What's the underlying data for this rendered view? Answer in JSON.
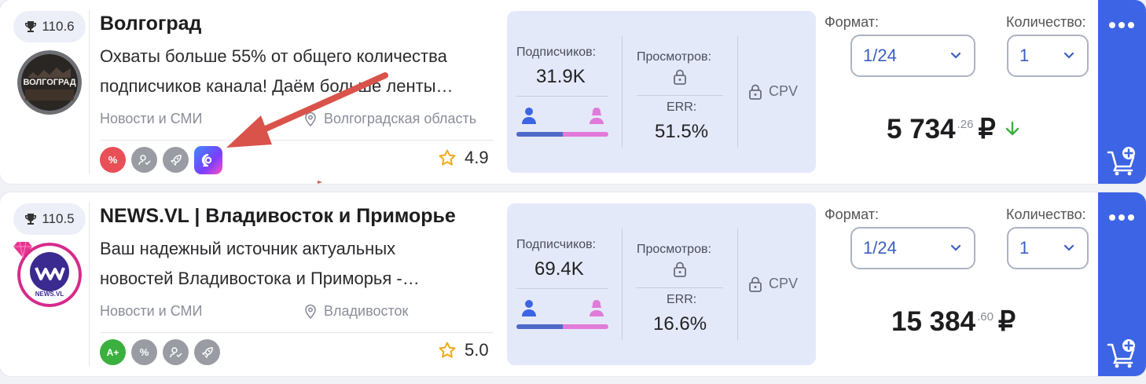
{
  "labels": {
    "subscribers": "Подписчиков:",
    "views": "Просмотров:",
    "err": "ERR:",
    "cpv": "CPV",
    "format": "Формат:",
    "quantity": "Количество:",
    "currency": "₽"
  },
  "channels": [
    {
      "rank": "110.6",
      "title": "Волгоград",
      "avatar_text": "ВОЛГОГРАД",
      "desc_line1": "Охваты больше 55% от общего количества",
      "desc_line2": "подписчиков канала! Даём больше ленты…",
      "category": "Новости и СМИ",
      "location": "Волгоградская область",
      "badges": [
        "%",
        "user-check",
        "rocket",
        "app"
      ],
      "rating": "4.9",
      "subscribers": "31.9K",
      "err_value": "51.5%",
      "male_share": 0.5,
      "format": "1/24",
      "quantity": "1",
      "price_main": "5 734",
      "price_cents": ".26",
      "price_trend": "down",
      "trend_color": "#3bb03f"
    },
    {
      "rank": "110.5",
      "title": "NEWS.VL | Владивосток и Приморье",
      "avatar_text": "NEWS.VL",
      "desc_line1": "Ваш надежный источник актуальных",
      "desc_line2": "новостей Владивостока и Приморья -…",
      "category": "Новости и СМИ",
      "location": "Владивосток",
      "badges": [
        "A+",
        "%",
        "user-check",
        "rocket"
      ],
      "rating": "5.0",
      "subscribers": "69.4K",
      "err_value": "16.6%",
      "male_share": 0.5,
      "format": "1/24",
      "quantity": "1",
      "price_main": "15 384",
      "price_cents": ".60",
      "price_trend": "",
      "trend_color": ""
    }
  ],
  "colors": {
    "accent": "#3d64e4",
    "stats_bg": "#e4e9fa",
    "select_text": "#3a5ec2",
    "annotation_arrow": "#d9534a"
  }
}
